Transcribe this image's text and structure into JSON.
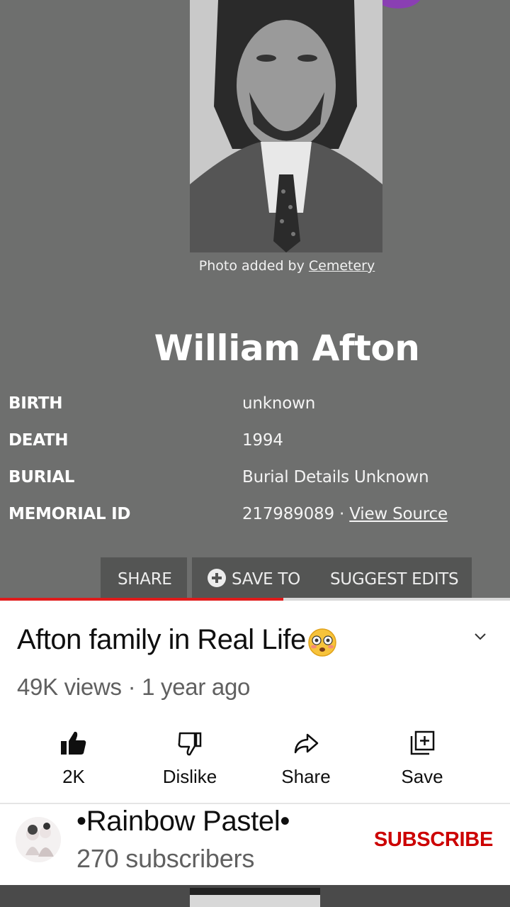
{
  "memorial": {
    "photo_credit_prefix": "Photo added by ",
    "photo_credit_link": "Cemetery",
    "name": "William Afton",
    "facts": [
      {
        "label": "BIRTH",
        "value": "unknown"
      },
      {
        "label": "DEATH",
        "value": "1994"
      },
      {
        "label": "BURIAL",
        "value": "Burial Details Unknown"
      },
      {
        "label": "MEMORIAL ID",
        "value": "217989089 · ",
        "link": "View Source"
      }
    ],
    "actions": {
      "share": "SHARE",
      "save_to": "SAVE TO",
      "suggest_edits": "SUGGEST EDITS"
    }
  },
  "player": {
    "progress": 0.555
  },
  "video": {
    "title": "Afton family in Real Life",
    "meta": "49K views · 1 year ago"
  },
  "actions": {
    "like": "2K",
    "dislike": "Dislike",
    "share": "Share",
    "save": "Save"
  },
  "channel": {
    "name": "•Rainbow Pastel•",
    "subscribers": "270 subscribers",
    "subscribe_label": "SUBSCRIBE"
  },
  "colors": {
    "subscribe": "#cc0000",
    "progress": "#e01b1b",
    "frame_bg": "#6e6f6e"
  }
}
